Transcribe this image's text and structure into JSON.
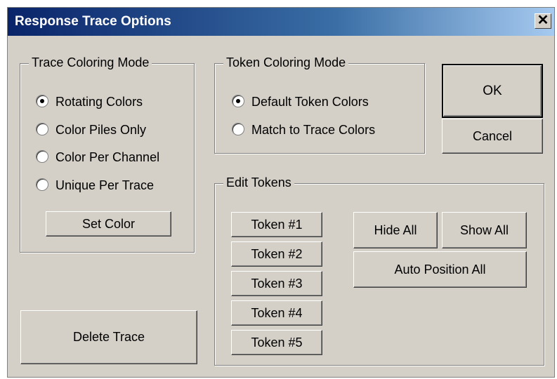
{
  "window": {
    "title": "Response Trace Options",
    "close_label": "✕"
  },
  "trace_coloring": {
    "legend": "Trace Coloring Mode",
    "options": [
      "Rotating Colors",
      "Color Piles Only",
      "Color Per Channel",
      "Unique Per Trace"
    ],
    "selected": "Rotating Colors",
    "set_color_label": "Set Color"
  },
  "token_coloring": {
    "legend": "Token Coloring Mode",
    "options": [
      "Default Token Colors",
      "Match to Trace Colors"
    ],
    "selected": "Default Token Colors"
  },
  "buttons": {
    "ok": "OK",
    "cancel": "Cancel",
    "delete_trace": "Delete Trace"
  },
  "edit_tokens": {
    "legend": "Edit Tokens",
    "tokens": [
      "Token #1",
      "Token #2",
      "Token #3",
      "Token #4",
      "Token #5"
    ],
    "hide_all": "Hide All",
    "show_all": "Show All",
    "auto_position_all": "Auto Position All"
  }
}
